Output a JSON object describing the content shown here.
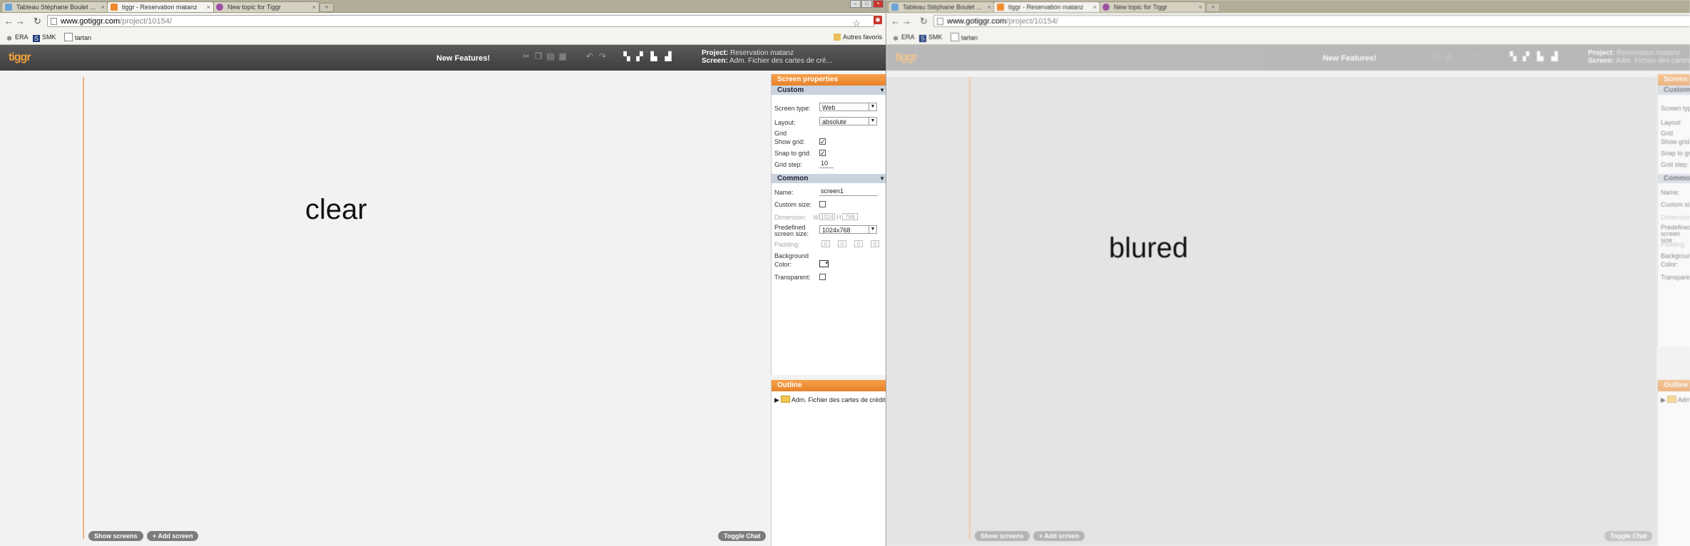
{
  "browser": {
    "tabs": [
      {
        "label": "Tableau Stéphane Boulet ..."
      },
      {
        "label": "tiggr - Reservation matanz"
      },
      {
        "label": "New topic for Tiggr"
      }
    ],
    "new_tab": "+",
    "url_host": "www.gotiggr.com",
    "url_path": "/project/10154/",
    "bookmarks": [
      {
        "label": "ERA",
        "icon": "gear-icon"
      },
      {
        "label": "SMK",
        "icon": "smk-icon"
      },
      {
        "label": "tartan",
        "icon": "page-icon"
      }
    ],
    "other_bookmarks": "Autres favoris"
  },
  "app": {
    "logo": "tiggr",
    "title": "New Features!",
    "project_label": "Project:",
    "project_value": "Reservation matanz",
    "screen_label": "Screen:",
    "screen_value": "Adm. Fichier des cartes de cré...",
    "accent": "#f08a2c"
  },
  "canvas": {
    "left_text": "clear",
    "right_text": "blured",
    "show_screens": "Show screens",
    "add_screen": "+ Add screen",
    "toggle_chat": "Toggle Chat"
  },
  "props": {
    "title": "Screen properties",
    "custom": "Custom",
    "screen_type_label": "Screen type:",
    "screen_type_value": "Web",
    "layout_label": "Layout:",
    "layout_value": "absolute",
    "grid_label": "Grid",
    "show_grid_label": "Show grid:",
    "show_grid": true,
    "snap_label": "Snap to grid:",
    "snap": true,
    "grid_step_label": "Grid step:",
    "grid_step": "10",
    "common": "Common",
    "name_label": "Name:",
    "name_value": "screen1",
    "custom_size_label": "Custom size:",
    "custom_size": false,
    "dimension_label": "Dimension:",
    "dim_w_label": "W",
    "dim_w": "1024",
    "dim_h_label": "H",
    "dim_h": "768",
    "predefined_label": "Predefined screen size:",
    "predefined_value": "1024x768",
    "padding_label": "Padding:",
    "padding_values": [
      "0",
      "0",
      "0",
      "0"
    ],
    "background_label": "Background",
    "color_label": "Color:",
    "transparent_label": "Transparent:",
    "transparent": false
  },
  "outline": {
    "title": "Outline",
    "item": "Adm. Fichier des cartes de crédit"
  },
  "blurred_props": {
    "title": "Screen p",
    "custom": "Custom",
    "screen_type_label": "Screen type",
    "layout_label": "Layout:",
    "grid_label": "Grid",
    "show_grid_label": "Show grid",
    "snap_label": "Snap to gri",
    "grid_step_label": "Grid step:",
    "common": "Commo",
    "name_label": "Name:",
    "custom_size_label": "Custom size",
    "dimension_label": "Dimension:",
    "predefined_label": "Predefined screen size",
    "padding_label": "Padding:",
    "background_label": "Backgroun",
    "color_label": "Color:",
    "transparent_label": "Transparen",
    "outline_title": "Outline",
    "outline_item": "Adm."
  }
}
